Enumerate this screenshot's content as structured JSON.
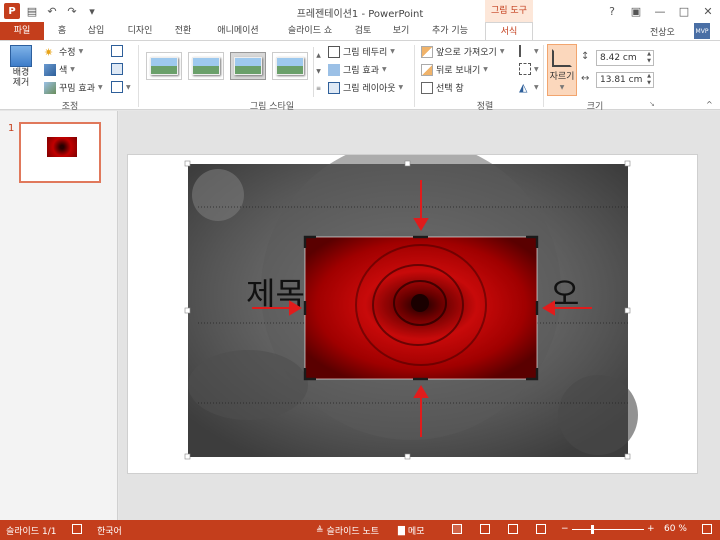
{
  "app_title": "프레젠테이션1 - PowerPoint",
  "context_tab": "그림 도구",
  "window_controls": [
    "?",
    "▣",
    "—",
    "□",
    "✕"
  ],
  "tabs": [
    {
      "label": "파일",
      "id": "file"
    },
    {
      "label": "홈",
      "id": "home"
    },
    {
      "label": "삽입",
      "id": "insert"
    },
    {
      "label": "디자인",
      "id": "design"
    },
    {
      "label": "전환",
      "id": "transitions"
    },
    {
      "label": "애니메이션",
      "id": "animations"
    },
    {
      "label": "슬라이드 쇼",
      "id": "slideshow"
    },
    {
      "label": "검토",
      "id": "review"
    },
    {
      "label": "보기",
      "id": "view"
    },
    {
      "label": "추가 기능",
      "id": "addins"
    },
    {
      "label": "서식",
      "id": "format"
    }
  ],
  "user": {
    "name": "전상오"
  },
  "ribbon": {
    "adjust": {
      "remove_bg": "배경\n제거",
      "corrections": "수정",
      "color": "색",
      "artistic": "꾸밈 효과",
      "label": "조정"
    },
    "styles": {
      "border": "그림 테두리",
      "effects": "그림 효과",
      "layout": "그림 레이아웃",
      "label": "그림 스타일"
    },
    "arrange": {
      "forward": "앞으로 가져오기",
      "backward": "뒤로 보내기",
      "selection": "선택 창",
      "label": "정렬"
    },
    "size": {
      "crop": "자르기",
      "height": "8.42 cm",
      "width": "13.81 cm",
      "label": "크기"
    }
  },
  "thumbnails": {
    "number": "1"
  },
  "slide": {
    "title_left": "제목",
    "title_right": "오"
  },
  "status": {
    "slide_pos": "슬라이드 1/1",
    "language": "한국어",
    "notes": "슬라이드 노트",
    "comments": "메모",
    "zoom": "60 %"
  },
  "colors": {
    "accent": "#c43e1c",
    "crop_handle": "#1a1a1a",
    "arrow": "#e01c1c"
  }
}
